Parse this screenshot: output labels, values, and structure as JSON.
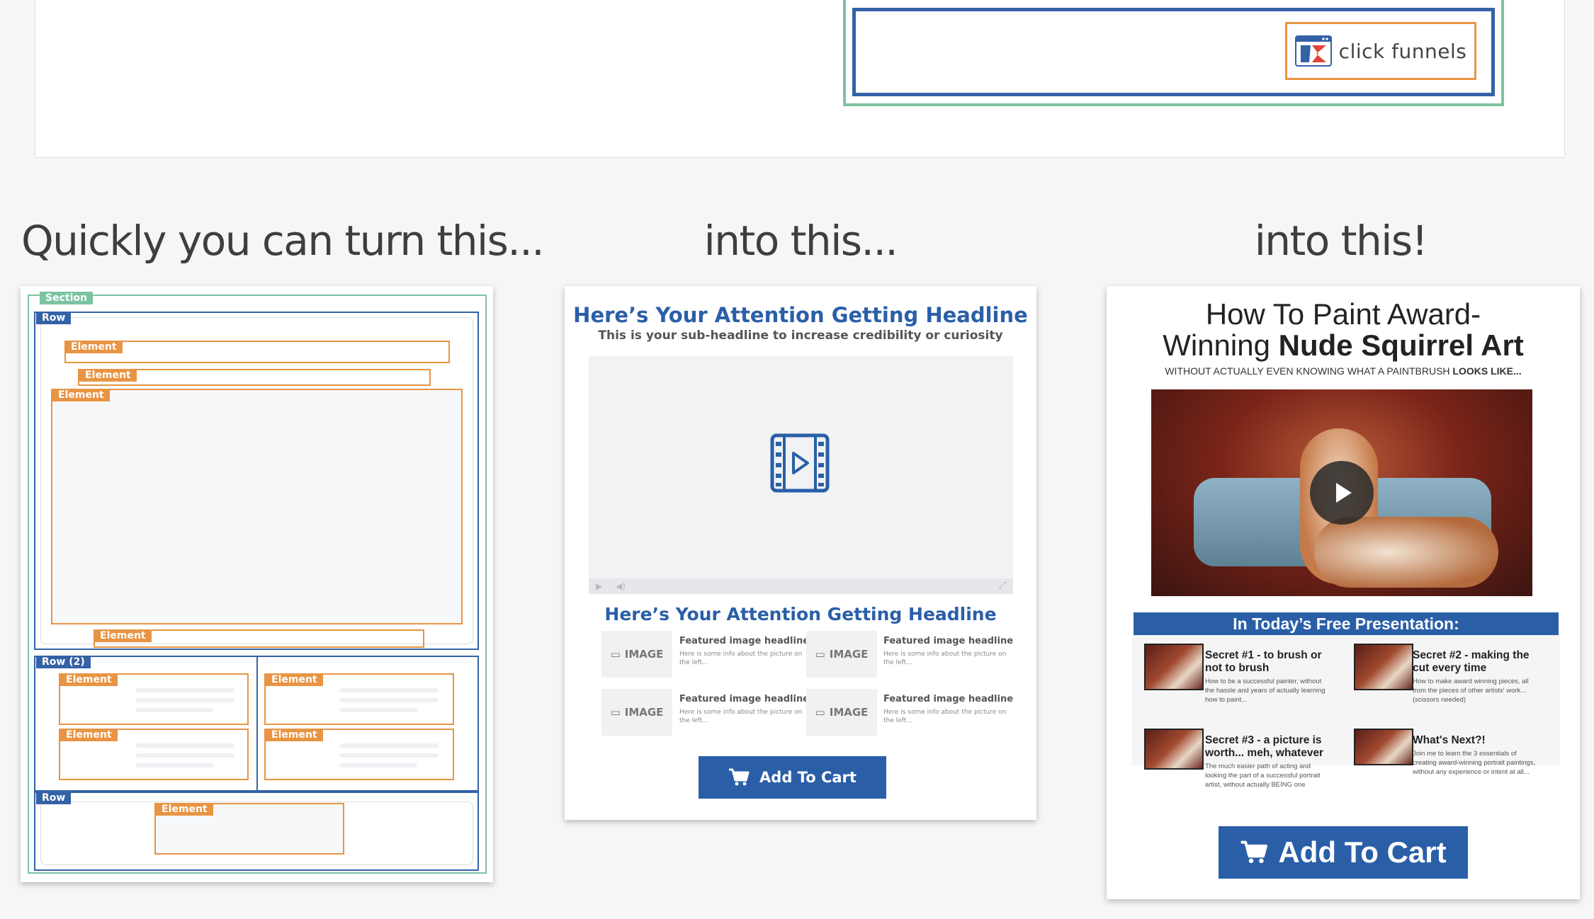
{
  "logo": {
    "icon": "clickfunnels-logo-icon",
    "text": "click funnels"
  },
  "headings": {
    "left": "Quickly you can turn this...",
    "middle": "into this...",
    "right": "into this!"
  },
  "wireframe": {
    "section_label": "Section",
    "row_label": "Row",
    "row2_label": "Row (2)",
    "element_label": "Element"
  },
  "template": {
    "headline": "Here’s Your Attention Getting Headline",
    "subheadline": "This is your sub-headline to increase credibility or curiosity",
    "video_icon": "video-film-play-icon",
    "headline2": "Here’s Your Attention Getting Headline",
    "features": [
      {
        "image_label": "IMAGE",
        "title": "Featured image headline",
        "text": "Here is some info about the picture on the left..."
      },
      {
        "image_label": "IMAGE",
        "title": "Featured image headline",
        "text": "Here is some info about the picture on the left..."
      },
      {
        "image_label": "IMAGE",
        "title": "Featured image headline",
        "text": "Here is some info about the picture on the left..."
      },
      {
        "image_label": "IMAGE",
        "title": "Featured image headline",
        "text": "Here is some info about the picture on the left..."
      }
    ],
    "cart_label": "Add To Cart",
    "cart_icon": "shopping-cart-icon"
  },
  "final": {
    "title_line1": "How To Paint Award-",
    "title_line2_plain": "Winning ",
    "title_line2_bold": "Nude Squirrel Art",
    "subtitle_plain": "WITHOUT ACTUALLY EVEN KNOWING WHAT A PAINTBRUSH ",
    "subtitle_bold": "LOOKS LIKE...",
    "banner": "In Today’s Free Presentation:",
    "secrets": [
      {
        "title": "Secret #1 - to brush or not to brush",
        "text": "How to be a successful painter, without the hassle and years of actually learning how to paint..."
      },
      {
        "title": "Secret #2 - making the cut every time",
        "text": "How to make award winning pieces, all from the pieces of other artists' work... (scissors needed)"
      },
      {
        "title": "Secret #3 - a picture is worth... meh, whatever",
        "text": "The much easier path of acting and looking the part of a successful portrait artist, without actually BEING one"
      },
      {
        "title": "What's Next?!",
        "text": "Join me to learn the 3 essentials of creating award-winning portrait paintings, without any experience or intent at all..."
      }
    ],
    "cart_label": "Add To Cart",
    "cart_icon": "shopping-cart-icon"
  }
}
